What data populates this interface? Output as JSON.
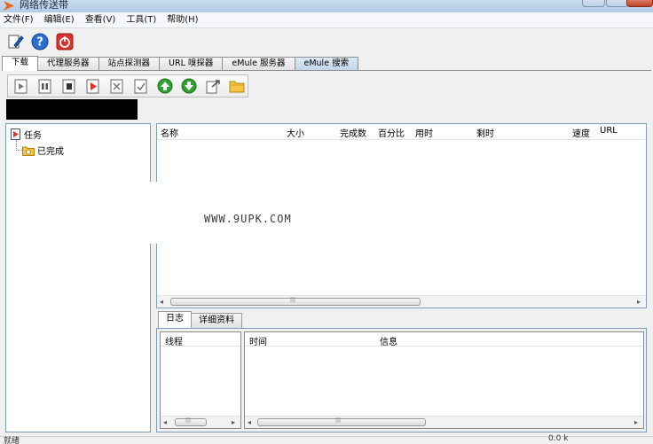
{
  "window": {
    "title": "网络传送带"
  },
  "menu": [
    "文件(F)",
    "编辑(E)",
    "查看(V)",
    "工具(T)",
    "帮助(H)"
  ],
  "toolbar": {
    "icons": [
      "new-task-icon",
      "help-icon",
      "power-icon"
    ]
  },
  "tabs": [
    {
      "label": "下载",
      "active": true
    },
    {
      "label": "代理服务器",
      "active": false
    },
    {
      "label": "站点探测器",
      "active": false
    },
    {
      "label": "URL 嗅探器",
      "active": false
    },
    {
      "label": "eMule 服务器",
      "active": false
    },
    {
      "label": "eMule 搜索",
      "active": false
    }
  ],
  "task_toolbar": {
    "icons": [
      "play-icon",
      "pause-icon",
      "stop-icon",
      "open-icon",
      "delete-icon",
      "properties-icon",
      "move-up-icon",
      "move-down-icon",
      "export-icon",
      "folder-icon"
    ]
  },
  "tree": {
    "root_label": "任务",
    "child_label": "已完成"
  },
  "list": {
    "columns": [
      "名称",
      "大小",
      "完成数",
      "百分比",
      "用时",
      "剩时",
      "速度",
      "URL"
    ]
  },
  "watermark": "WWW.9UPK.COM",
  "bottom_tabs": [
    {
      "label": "日志",
      "active": true
    },
    {
      "label": "详细资料",
      "active": false
    }
  ],
  "thread_pane": {
    "header": "线程"
  },
  "log_pane": {
    "columns": [
      "时间",
      "信息"
    ]
  },
  "statusbar": {
    "left_text": "就绪",
    "right_text": "0.0 k"
  },
  "colors": {
    "accent_green": "#2fa32f",
    "accent_red": "#d9342b",
    "accent_blue": "#1b5fb8",
    "border_blue": "#7f9db9"
  }
}
